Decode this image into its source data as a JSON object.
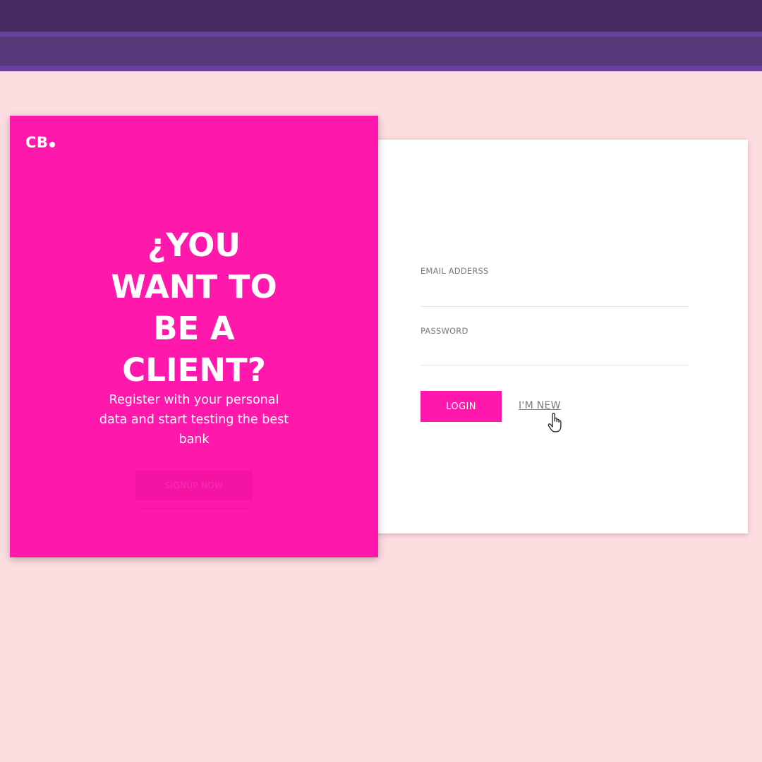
{
  "header": {
    "bar_colors": {
      "dark": "#452a5f",
      "mid": "#573879",
      "accent": "#6b3fa0"
    }
  },
  "promo": {
    "logo": "CB",
    "headline": "¿YOU WANT TO BE A CLIENT?",
    "subtext": "Register with your personal data and start testing the best bank",
    "signup_label": "SIGNUP NOW",
    "background_color": "#ff18ac"
  },
  "login": {
    "email_label": "EMAIL ADDERSS",
    "password_label": "PASSWORD",
    "login_button": "LOGIN",
    "new_link": "I'M NEW",
    "accent_color": "#ff18ac"
  },
  "cursor": {
    "icon": "hand-pointer-icon"
  },
  "page": {
    "background_color": "#fddde0"
  }
}
